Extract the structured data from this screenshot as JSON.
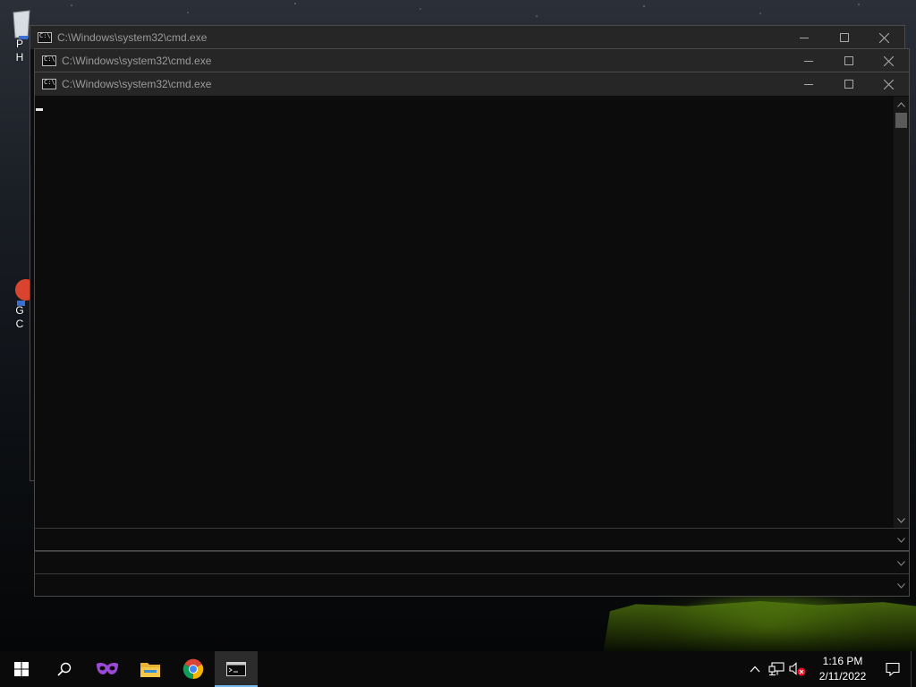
{
  "desktop": {
    "icons": [
      {
        "label_1": "P",
        "label_2": "H",
        "icon": "recycle-bin-icon"
      },
      {
        "label_1": "G",
        "label_2": "C",
        "icon": "google-chrome-shortcut-icon"
      }
    ]
  },
  "windows": [
    {
      "title": "C:\\Windows\\system32\\cmd.exe"
    },
    {
      "title": "C:\\Windows\\system32\\cmd.exe"
    },
    {
      "title": "C:\\Windows\\system32\\cmd.exe"
    }
  ],
  "taskbar": {
    "apps": [
      {
        "name": "start",
        "icon": "windows-start-icon"
      },
      {
        "name": "search",
        "icon": "search-icon"
      },
      {
        "name": "masked-app",
        "icon": "purple-mask-icon"
      },
      {
        "name": "file-explorer",
        "icon": "folder-icon"
      },
      {
        "name": "chrome",
        "icon": "chrome-icon"
      },
      {
        "name": "cmd",
        "icon": "cmd-icon",
        "active": true
      }
    ],
    "tray": {
      "icons": [
        "chevron-up-icon",
        "network-icon",
        "volume-muted-icon"
      ],
      "time": "1:16 PM",
      "date": "2/11/2022"
    }
  },
  "colors": {
    "titlebar": "#262626",
    "console_bg": "#0c0c0c",
    "active_underline": "#76b9ed"
  }
}
